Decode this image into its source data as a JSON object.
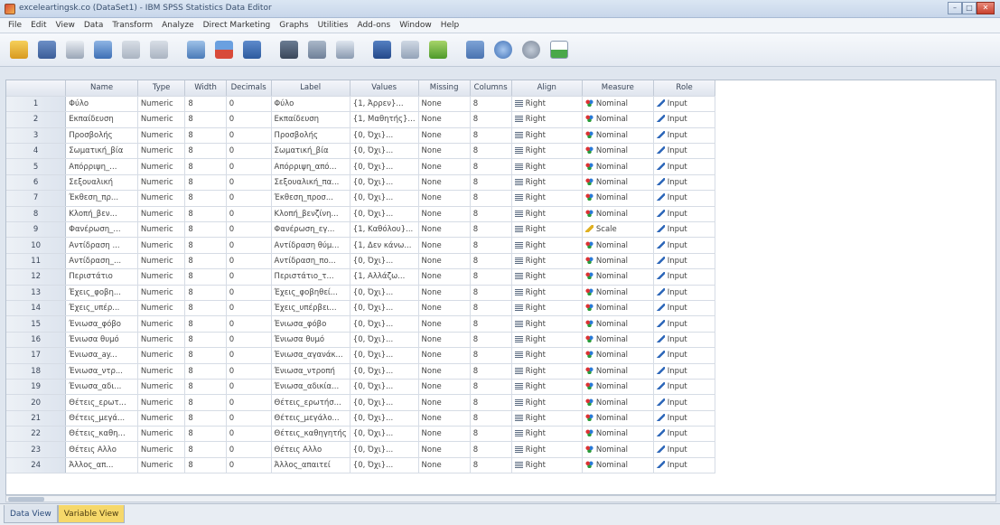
{
  "window": {
    "title": "exceleartingsk.co (DataSet1) - IBM SPSS Statistics Data Editor",
    "buttons": [
      "–",
      "□",
      "✕"
    ]
  },
  "menu": [
    "File",
    "Edit",
    "View",
    "Data",
    "Transform",
    "Analyze",
    "Direct Marketing",
    "Graphs",
    "Utilities",
    "Add-ons",
    "Window",
    "Help"
  ],
  "toolbar_icons": [
    "open-icon",
    "save-icon",
    "print-icon",
    "dialog-recall-icon",
    "undo-icon",
    "redo-icon",
    "goto-case-icon",
    "goto-variable-icon",
    "variables-icon",
    "find-icon",
    "insert-cases-icon",
    "insert-variable-icon",
    "split-file-icon",
    "weight-cases-icon",
    "select-cases-icon",
    "value-labels-icon",
    "use-sets-icon",
    "show-all-icon",
    "spelling-icon"
  ],
  "columns": [
    "Name",
    "Type",
    "Width",
    "Decimals",
    "Label",
    "Values",
    "Missing",
    "Columns",
    "Align",
    "Measure",
    "Role"
  ],
  "rows": [
    [
      "1",
      "Φύλο",
      "Numeric",
      "8",
      "0",
      "Φύλο",
      "{1, Άρρεν}...",
      "None",
      "8",
      "Right",
      "Nominal",
      "Input"
    ],
    [
      "2",
      "Εκπαίδευση",
      "Numeric",
      "8",
      "0",
      "Εκπαίδευση",
      "{1, Μαθητής}...",
      "None",
      "8",
      "Right",
      "Nominal",
      "Input"
    ],
    [
      "3",
      "Προσβολής",
      "Numeric",
      "8",
      "0",
      "Προσβολής",
      "{0, Όχι}...",
      "None",
      "8",
      "Right",
      "Nominal",
      "Input"
    ],
    [
      "4",
      "Σωματική_βία",
      "Numeric",
      "8",
      "0",
      "Σωματική_βία",
      "{0, Όχι}...",
      "None",
      "8",
      "Right",
      "Nominal",
      "Input"
    ],
    [
      "5",
      "Απόρριψη_...",
      "Numeric",
      "8",
      "0",
      "Απόρριψη_από...",
      "{0, Όχι}...",
      "None",
      "8",
      "Right",
      "Nominal",
      "Input"
    ],
    [
      "6",
      "Σεξουαλική",
      "Numeric",
      "8",
      "0",
      "Σεξουαλική_πα...",
      "{0, Όχι}...",
      "None",
      "8",
      "Right",
      "Nominal",
      "Input"
    ],
    [
      "7",
      "Έκθεση_πρ...",
      "Numeric",
      "8",
      "0",
      "Έκθεση_προσ...",
      "{0, Όχι}...",
      "None",
      "8",
      "Right",
      "Nominal",
      "Input"
    ],
    [
      "8",
      "Κλοπή_βεν...",
      "Numeric",
      "8",
      "0",
      "Κλοπή_βενζίνη...",
      "{0, Όχι}...",
      "None",
      "8",
      "Right",
      "Nominal",
      "Input"
    ],
    [
      "9",
      "Φανέρωση_...",
      "Numeric",
      "8",
      "0",
      "Φανέρωση_εγ...",
      "{1, Καθόλου}...",
      "None",
      "8",
      "Right",
      "Scale",
      "Input"
    ],
    [
      "10",
      "Αντίδραση ...",
      "Numeric",
      "8",
      "0",
      "Αντίδραση θύμ...",
      "{1, Δεν κάνω...",
      "None",
      "8",
      "Right",
      "Nominal",
      "Input"
    ],
    [
      "11",
      "Αντίδραση_...",
      "Numeric",
      "8",
      "0",
      "Αντίδραση_πο...",
      "{0, Όχι}...",
      "None",
      "8",
      "Right",
      "Nominal",
      "Input"
    ],
    [
      "12",
      "Περιστάτιο",
      "Numeric",
      "8",
      "0",
      "Περιστάτιο_τ...",
      "{1, Αλλάζω...",
      "None",
      "8",
      "Right",
      "Nominal",
      "Input"
    ],
    [
      "13",
      "Έχεις_φοβη...",
      "Numeric",
      "8",
      "0",
      "Έχεις_φοβηθεί...",
      "{0, Όχι}...",
      "None",
      "8",
      "Right",
      "Nominal",
      "Input"
    ],
    [
      "14",
      "Έχεις_υπέρ...",
      "Numeric",
      "8",
      "0",
      "Έχεις_υπέρβει...",
      "{0, Όχι}...",
      "None",
      "8",
      "Right",
      "Nominal",
      "Input"
    ],
    [
      "15",
      "Ένιωσα_φόβο",
      "Numeric",
      "8",
      "0",
      "Ένιωσα_φόβο",
      "{0, Όχι}...",
      "None",
      "8",
      "Right",
      "Nominal",
      "Input"
    ],
    [
      "16",
      "Ένιωσα θυμό",
      "Numeric",
      "8",
      "0",
      "Ένιωσα θυμό",
      "{0, Όχι}...",
      "None",
      "8",
      "Right",
      "Nominal",
      "Input"
    ],
    [
      "17",
      "Ένιωσα_ay...",
      "Numeric",
      "8",
      "0",
      "Ένιωσα_αγανάκ...",
      "{0, Όχι}...",
      "None",
      "8",
      "Right",
      "Nominal",
      "Input"
    ],
    [
      "18",
      "Ένιωσα_ντρ...",
      "Numeric",
      "8",
      "0",
      "Ένιωσα_ντροπή",
      "{0, Όχι}...",
      "None",
      "8",
      "Right",
      "Nominal",
      "Input"
    ],
    [
      "19",
      "Ένιωσα_αδι...",
      "Numeric",
      "8",
      "0",
      "Ένιωσα_αδικία...",
      "{0, Όχι}...",
      "None",
      "8",
      "Right",
      "Nominal",
      "Input"
    ],
    [
      "20",
      "Θέτεις_ερωτ...",
      "Numeric",
      "8",
      "0",
      "Θέτεις_ερωτήσ...",
      "{0, Όχι}...",
      "None",
      "8",
      "Right",
      "Nominal",
      "Input"
    ],
    [
      "21",
      "Θέτεις_μεγά...",
      "Numeric",
      "8",
      "0",
      "Θέτεις_μεγάλο...",
      "{0, Όχι}...",
      "None",
      "8",
      "Right",
      "Nominal",
      "Input"
    ],
    [
      "22",
      "Θέτεις_καθη...",
      "Numeric",
      "8",
      "0",
      "Θέτεις_καθηγητής",
      "{0, Όχι}...",
      "None",
      "8",
      "Right",
      "Nominal",
      "Input"
    ],
    [
      "23",
      "Θέτεις Αλλο",
      "Numeric",
      "8",
      "0",
      "Θέτεις Αλλο",
      "{0, Όχι}...",
      "None",
      "8",
      "Right",
      "Nominal",
      "Input"
    ],
    [
      "24",
      "Άλλος_απ...",
      "Numeric",
      "8",
      "0",
      "Άλλος_απαιτεί",
      "{0, Όχι}...",
      "None",
      "8",
      "Right",
      "Nominal",
      "Input"
    ]
  ],
  "tabs": [
    "Data View",
    "Variable View"
  ],
  "active_tab": "Variable View",
  "colors": {
    "active_tab": "#f6d86a",
    "titlebar": "#c7d6ea"
  }
}
